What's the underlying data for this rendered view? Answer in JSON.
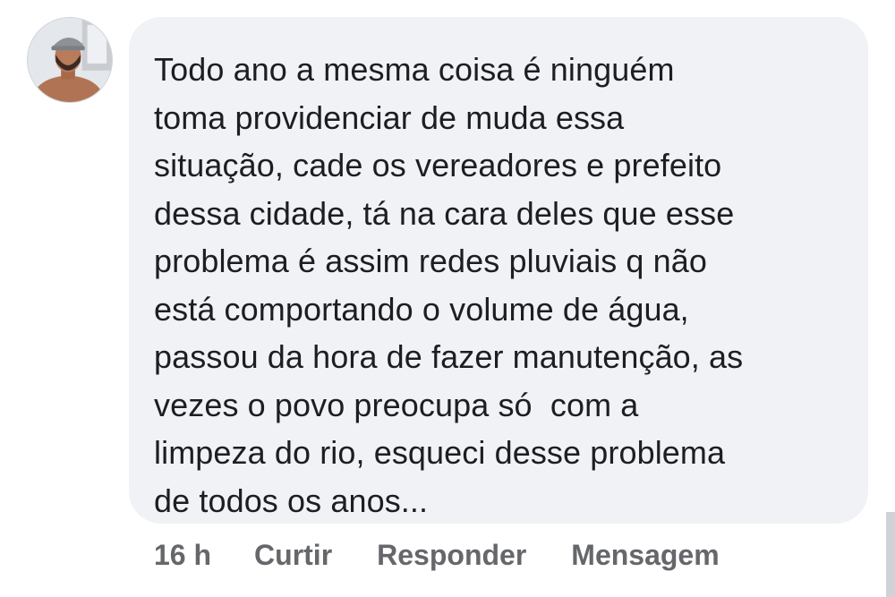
{
  "comment": {
    "avatar_icon": "user-avatar-photo",
    "text_lines": [
      "Todo ano a mesma coisa é ninguém",
      "toma providenciar de muda essa",
      "situação, cade os vereadores e prefeito",
      "dessa cidade, tá na cara deles que esse",
      "problema é assim redes pluviais q não",
      "está comportando o volume de água,",
      "passou da hora de fazer manutenção, as",
      "vezes o povo preocupa só  com a",
      "limpeza do rio, esqueci desse problema",
      "de todos os anos..."
    ]
  },
  "actions": {
    "time": "16 h",
    "like_label": "Curtir",
    "reply_label": "Responder",
    "message_label": "Mensagem"
  },
  "colors": {
    "bubble_bg": "#f0f2f5",
    "text": "#1c1e21",
    "action_text": "#65676b"
  }
}
